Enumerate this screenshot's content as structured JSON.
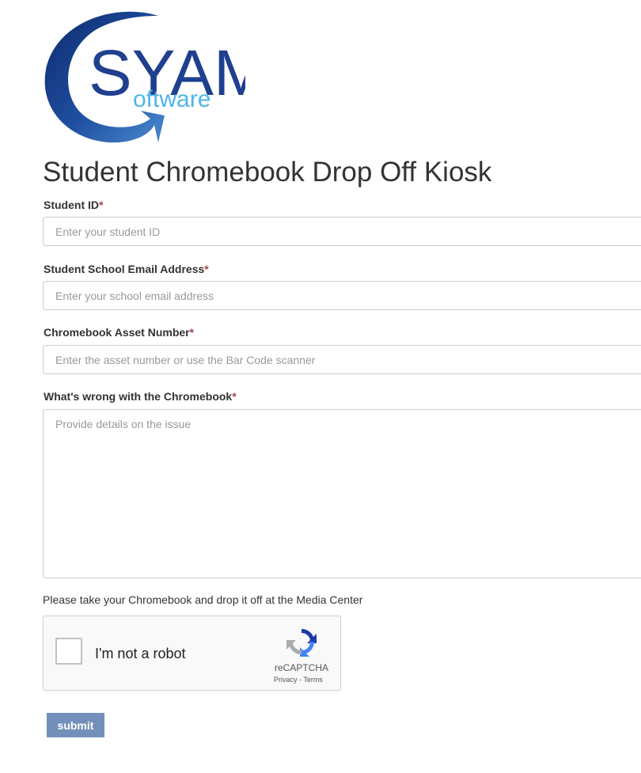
{
  "logo": {
    "text_main": "SYAM",
    "text_sub": "oftware"
  },
  "page_title": "Student Chromebook Drop Off Kiosk",
  "fields": [
    {
      "label": "Student ID",
      "required_mark": "*",
      "placeholder": "Enter your student ID",
      "value": ""
    },
    {
      "label": "Student School Email Address",
      "required_mark": "*",
      "placeholder": "Enter your school email address",
      "value": ""
    },
    {
      "label": "Chromebook Asset Number",
      "required_mark": "*",
      "placeholder": "Enter the asset number or use the Bar Code scanner",
      "value": ""
    },
    {
      "label": "What's wrong with the Chromebook",
      "required_mark": "*",
      "placeholder": "Provide details on the issue",
      "value": ""
    }
  ],
  "note": "Please take your Chromebook and drop it off at the Media Center",
  "captcha": {
    "label": "I'm not a robot",
    "checked": false,
    "brand": "reCAPTCHA",
    "privacy_link": "Privacy",
    "separator": " - ",
    "terms_link": "Terms"
  },
  "submit_label": "submit",
  "colors": {
    "submit_bg": "#7390ba",
    "logo_dark_blue": "#1f3f8f",
    "logo_light_blue": "#4fb6e8",
    "required": "#a94442"
  }
}
